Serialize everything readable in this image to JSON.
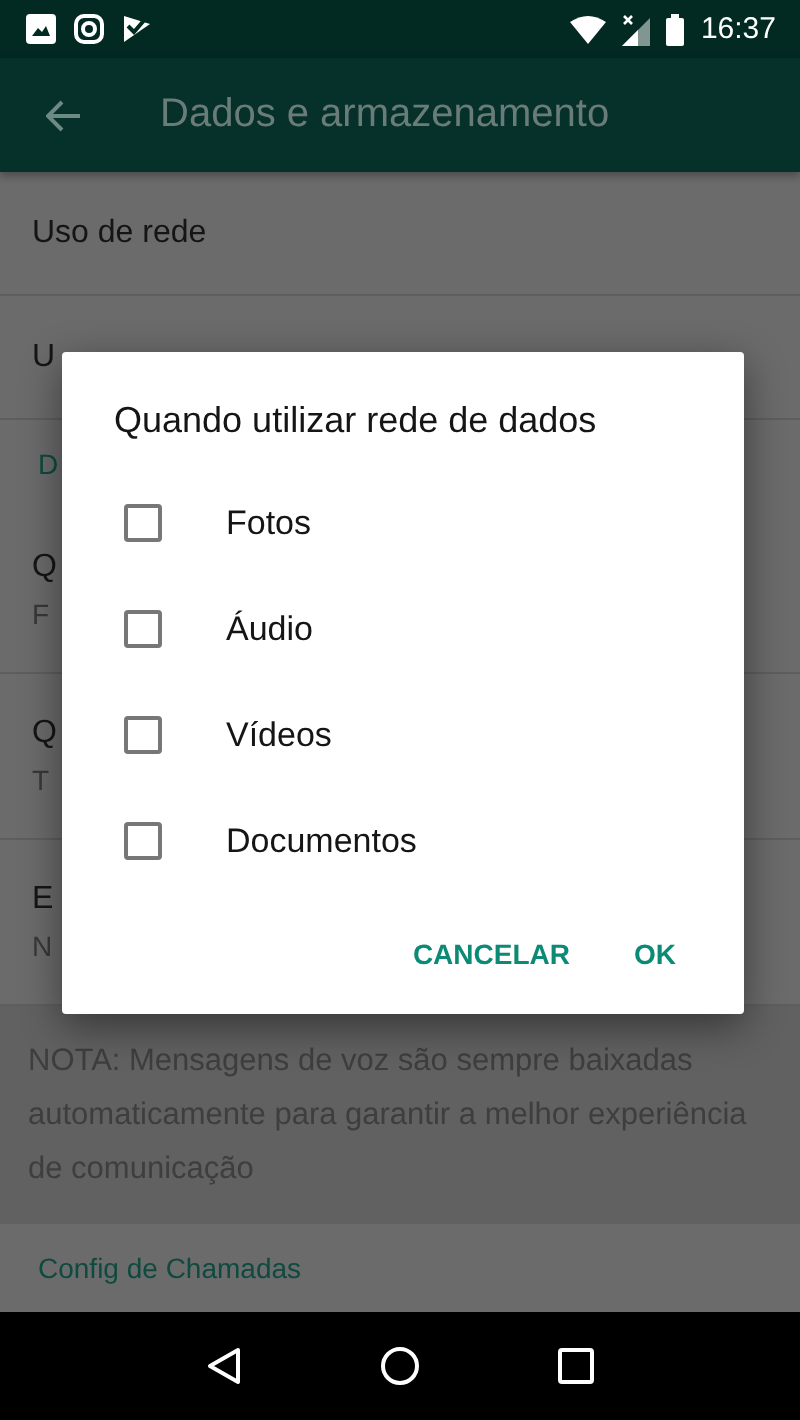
{
  "status_bar": {
    "time": "16:37"
  },
  "toolbar": {
    "title": "Dados e armazenamento"
  },
  "settings": [
    {
      "kind": "row",
      "title": "Uso de rede"
    },
    {
      "kind": "row",
      "title": "U"
    },
    {
      "kind": "section",
      "title": "D"
    },
    {
      "kind": "row",
      "title": "Q",
      "subtitle": "F"
    },
    {
      "kind": "row",
      "title": "Q",
      "subtitle": "T"
    },
    {
      "kind": "row",
      "title": "E",
      "subtitle": "N"
    },
    {
      "kind": "note",
      "title": "NOTA: Mensagens de voz são sempre baixadas automaticamente para garantir a melhor experiência de comunicação"
    },
    {
      "kind": "section",
      "title": "Config de Chamadas"
    }
  ],
  "dialog": {
    "title": "Quando utilizar rede de dados",
    "options": [
      {
        "label": "Fotos",
        "checked": false
      },
      {
        "label": "Áudio",
        "checked": false
      },
      {
        "label": "Vídeos",
        "checked": false
      },
      {
        "label": "Documentos",
        "checked": false
      }
    ],
    "buttons": [
      "CANCELAR",
      "OK"
    ]
  }
}
